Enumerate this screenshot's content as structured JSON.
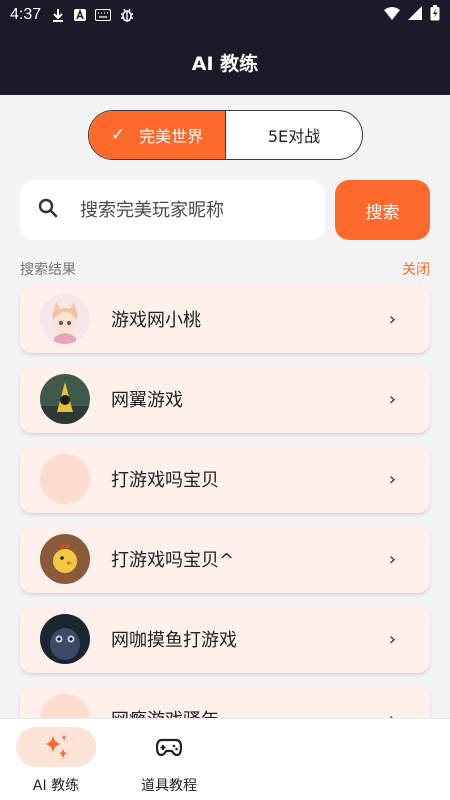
{
  "status_bar": {
    "time": "4:37",
    "left_icons": [
      "download-icon",
      "font-a-icon",
      "keyboard-icon",
      "bug-icon"
    ],
    "right_icons": [
      "wifi-icon",
      "signal-icon",
      "battery-charging-icon"
    ]
  },
  "app_bar": {
    "title": "AI 教练"
  },
  "segments": {
    "active_label": "完美世界",
    "other_label": "5E对战"
  },
  "search": {
    "placeholder": "搜索完美玩家昵称",
    "button_label": "搜索"
  },
  "results": {
    "label": "搜索结果",
    "close_label": "关闭",
    "items": [
      {
        "name": "游戏网小桃"
      },
      {
        "name": "网翼游戏"
      },
      {
        "name": "打游戏吗宝贝"
      },
      {
        "name": "打游戏吗宝贝^"
      },
      {
        "name": "网咖摸鱼打游戏"
      },
      {
        "name": "网瘾游戏骚年"
      }
    ]
  },
  "bottom_nav": {
    "tabs": [
      {
        "label": "AI 教练",
        "icon": "sparkle-icon"
      },
      {
        "label": "道具教程",
        "icon": "gamepad-icon"
      }
    ]
  },
  "colors": {
    "accent": "#ff6a2c",
    "header_bg": "#1a1b28",
    "card_bg": "#fff0ec",
    "page_bg": "#f3f2f4"
  }
}
